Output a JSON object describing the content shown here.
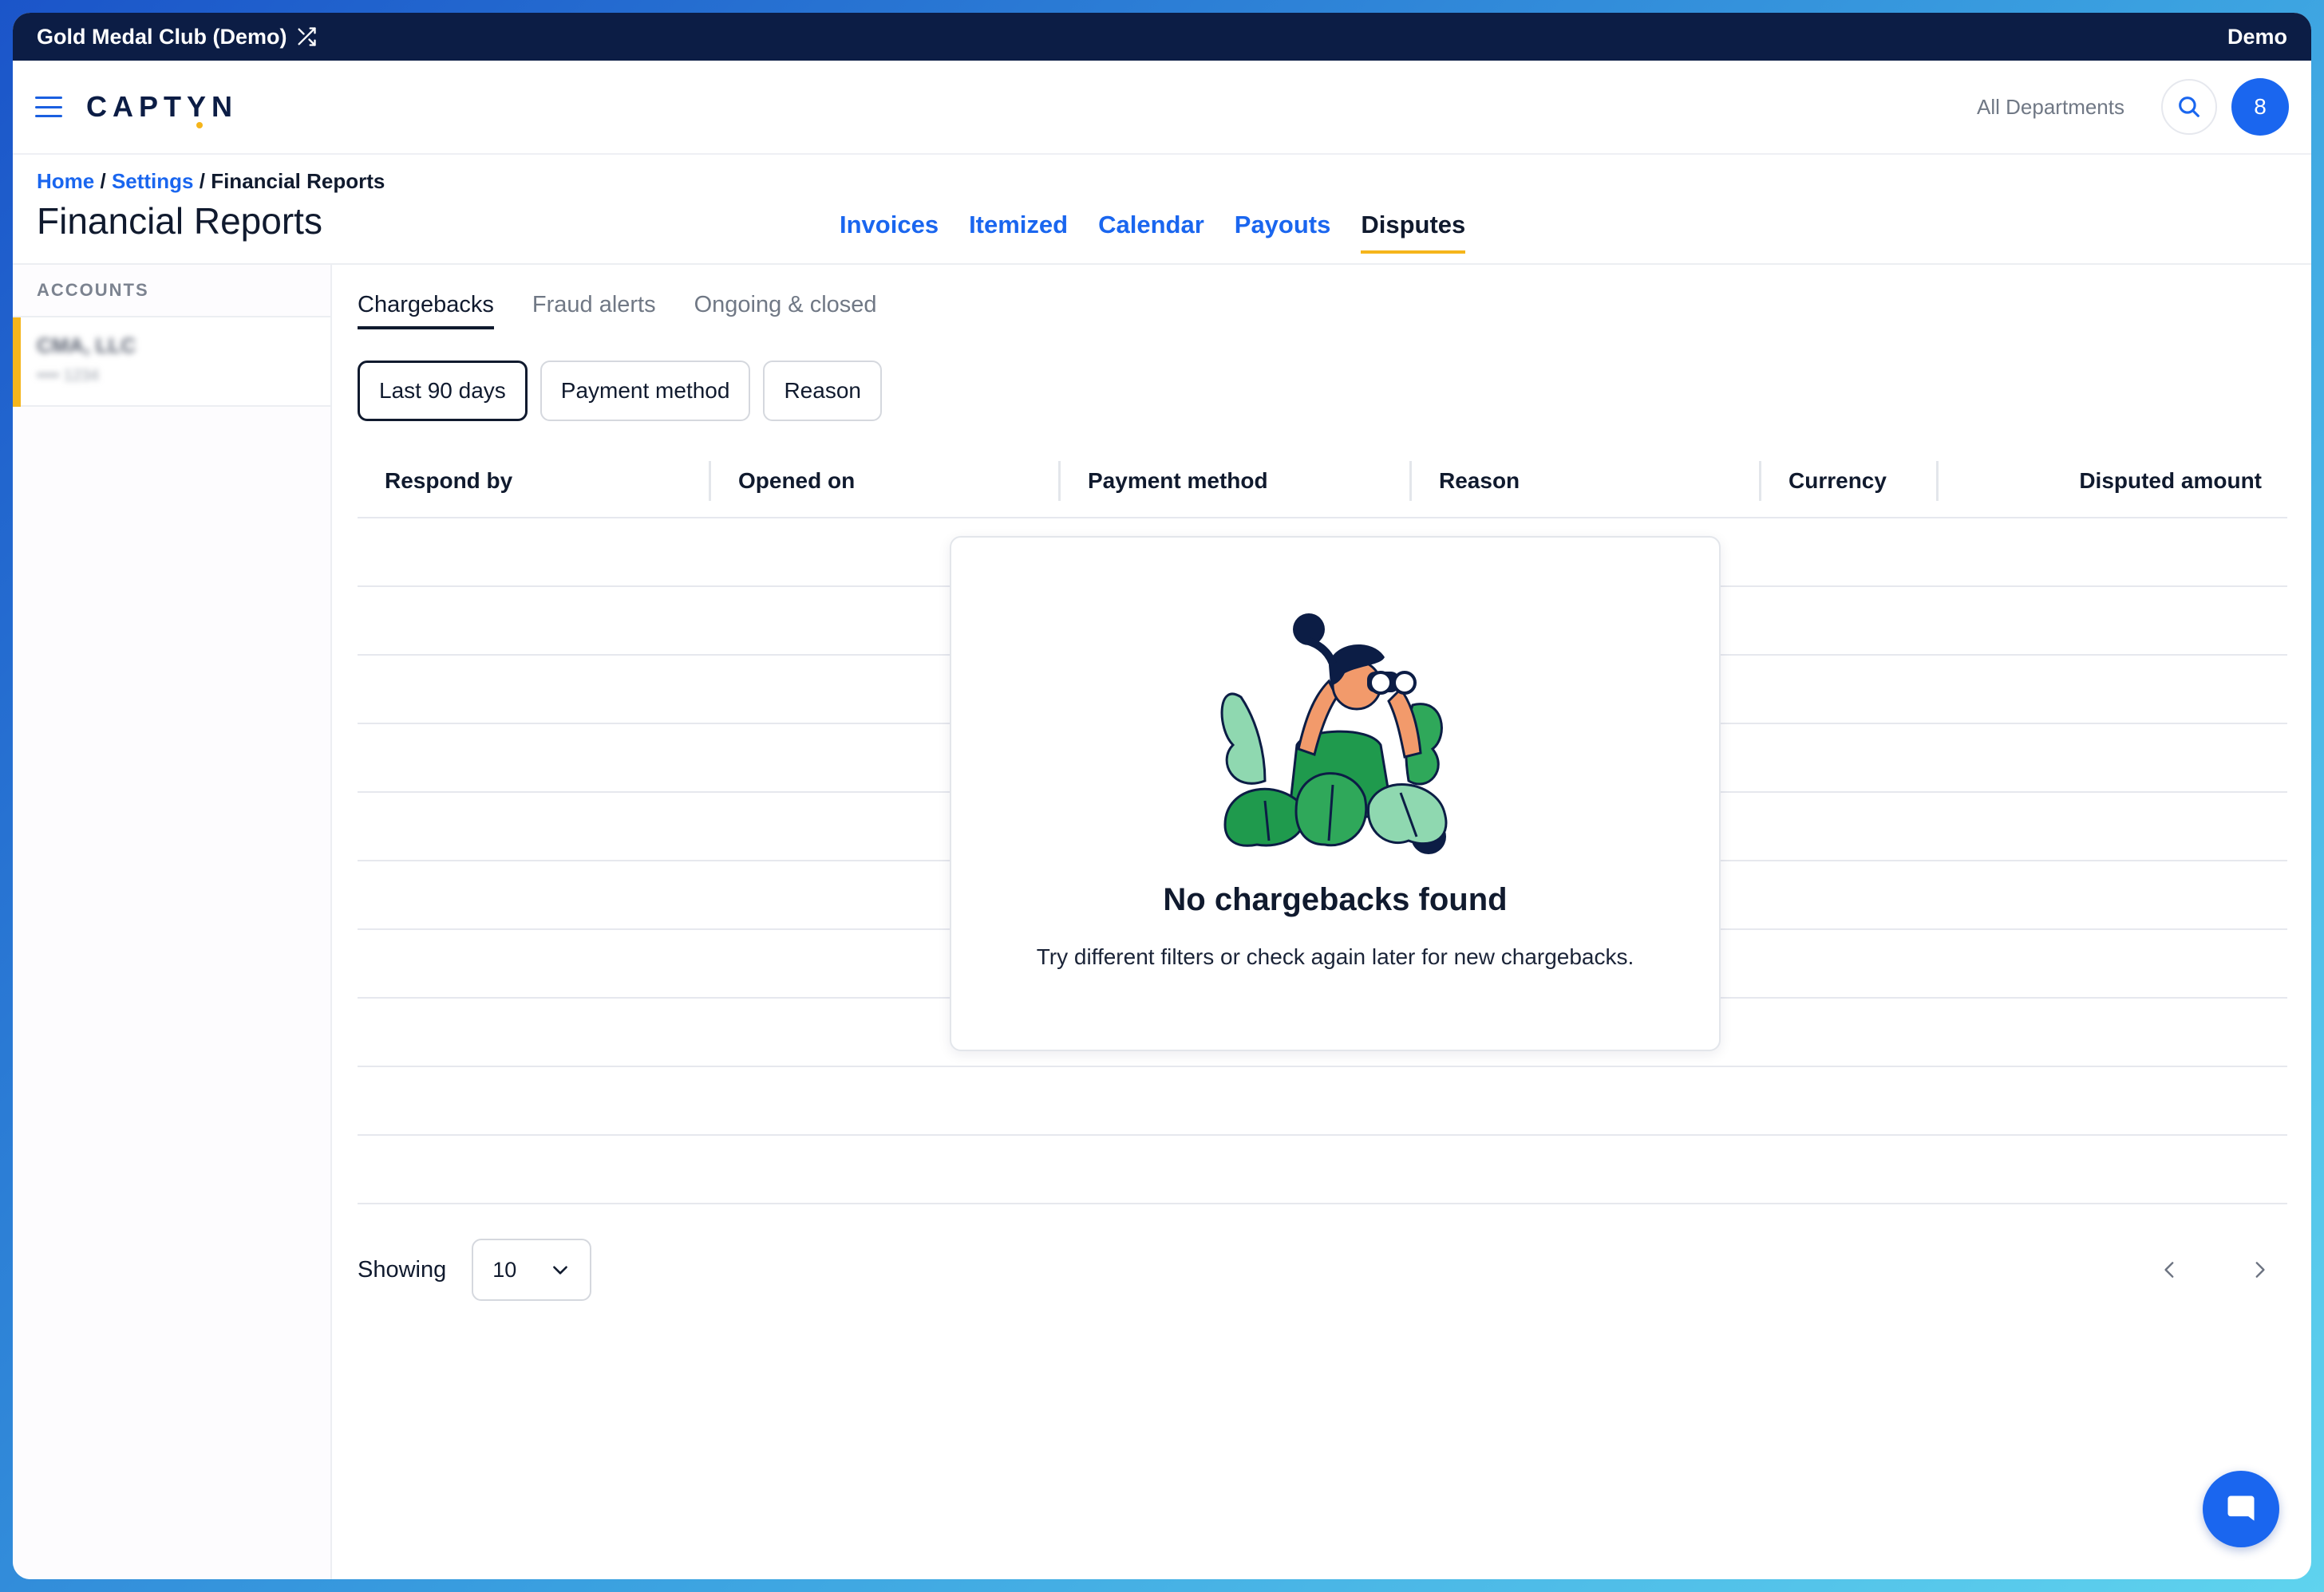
{
  "topbar": {
    "club_name": "Gold Medal Club (Demo)",
    "mode_label": "Demo"
  },
  "header": {
    "logo": "CAPTYN",
    "department": "All Departments",
    "avatar_initial": "8"
  },
  "breadcrumb": {
    "home": "Home",
    "settings": "Settings",
    "current": "Financial Reports"
  },
  "page": {
    "title": "Financial Reports"
  },
  "main_tabs": [
    {
      "label": "Invoices"
    },
    {
      "label": "Itemized"
    },
    {
      "label": "Calendar"
    },
    {
      "label": "Payouts"
    },
    {
      "label": "Disputes"
    }
  ],
  "sidebar": {
    "heading": "ACCOUNTS",
    "items": [
      {
        "name": "CMA, LLC",
        "sub": "•••• 1234"
      }
    ]
  },
  "sub_tabs": [
    {
      "label": "Chargebacks"
    },
    {
      "label": "Fraud alerts"
    },
    {
      "label": "Ongoing & closed"
    }
  ],
  "filters": [
    {
      "label": "Last 90 days"
    },
    {
      "label": "Payment method"
    },
    {
      "label": "Reason"
    }
  ],
  "table": {
    "columns": [
      "Respond by",
      "Opened on",
      "Payment method",
      "Reason",
      "Currency",
      "Disputed amount"
    ]
  },
  "empty_state": {
    "title": "No chargebacks found",
    "message": "Try different filters or check again later for new chargebacks."
  },
  "footer": {
    "showing_label": "Showing",
    "page_size": "10"
  },
  "colors": {
    "accent": "#1a66ef",
    "highlight": "#f5b51b",
    "topbar": "#0c1d45"
  }
}
